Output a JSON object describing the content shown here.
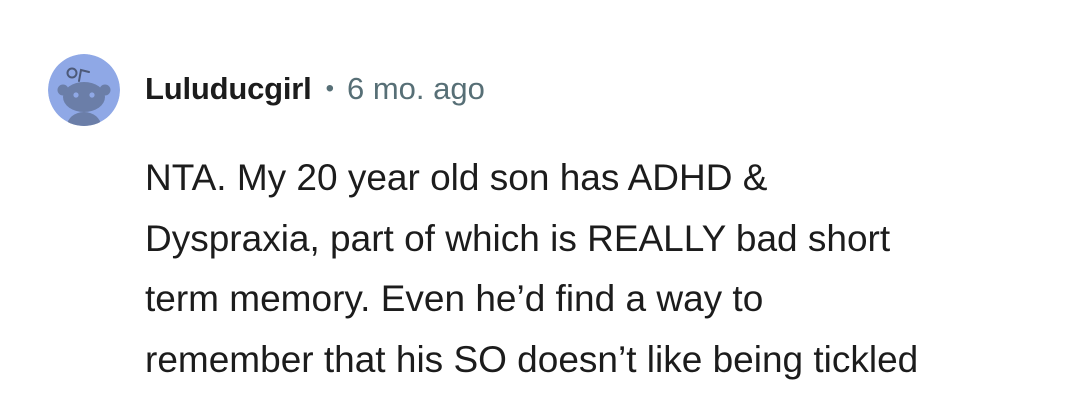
{
  "comment": {
    "avatar_icon": "snoo-avatar-icon",
    "avatar_color": "#8fa8e6",
    "username": "Luluducgirl",
    "separator": "•",
    "timestamp": "6 mo. ago",
    "body_lines": [
      "NTA. My 20 year old son has ADHD &",
      "Dyspraxia, part of which is REALLY bad short",
      "term memory. Even he’d find a way to",
      "remember that his SO doesn’t like being tickled"
    ]
  }
}
